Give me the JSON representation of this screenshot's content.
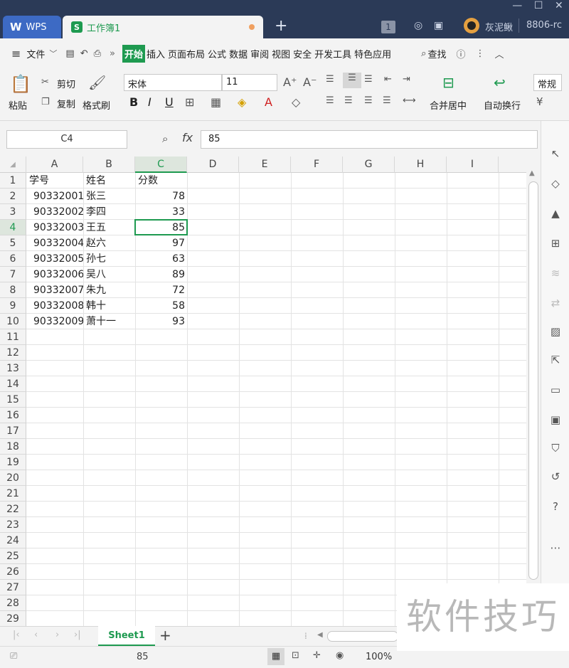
{
  "titlebar": {
    "wps_label": "WPS",
    "workbook_tab": "工作簿1",
    "username": "灰泥鳅",
    "account": "8806-rc",
    "badge": "1"
  },
  "menu": {
    "file": "文件",
    "tabs": [
      "开始",
      "插入",
      "页面布局",
      "公式",
      "数据",
      "审阅",
      "视图",
      "安全",
      "开发工具",
      "特色应用"
    ],
    "search": "查找"
  },
  "ribbon": {
    "paste": "粘贴",
    "cut": "剪切",
    "copy": "复制",
    "format_painter": "格式刷",
    "font_name": "宋体",
    "font_size": "11",
    "merge_center": "合并居中",
    "wrap_text": "自动换行",
    "number_format": "常规"
  },
  "formula_bar": {
    "name_box": "C4",
    "fx": "fx",
    "value": "85"
  },
  "sheet": {
    "columns": [
      "A",
      "B",
      "C",
      "D",
      "E",
      "F",
      "G",
      "H",
      "I"
    ],
    "row_numbers": [
      "1",
      "2",
      "3",
      "4",
      "5",
      "6",
      "7",
      "8",
      "9",
      "10",
      "11",
      "12",
      "13",
      "14",
      "15",
      "16",
      "17",
      "18",
      "19",
      "20",
      "21",
      "22",
      "23",
      "24",
      "25",
      "26",
      "27",
      "28",
      "29"
    ],
    "header": [
      "学号",
      "姓名",
      "分数"
    ],
    "rows": [
      [
        "90332001",
        "张三",
        "78"
      ],
      [
        "90332002",
        "李四",
        "33"
      ],
      [
        "90332003",
        "王五",
        "85"
      ],
      [
        "90332004",
        "赵六",
        "97"
      ],
      [
        "90332005",
        "孙七",
        "63"
      ],
      [
        "90332006",
        "吴八",
        "89"
      ],
      [
        "90332007",
        "朱九",
        "72"
      ],
      [
        "90332008",
        "韩十",
        "58"
      ],
      [
        "90332009",
        "萧十一",
        "93"
      ]
    ],
    "selected_cell": "C4"
  },
  "sheet_tabs": [
    "Sheet1"
  ],
  "status": {
    "value": "85",
    "zoom": "100%"
  },
  "watermark": "软件技巧",
  "colors": {
    "accent": "#1e9a50",
    "titlebar": "#2b3a57",
    "wps_tab": "#3d6ac4"
  }
}
